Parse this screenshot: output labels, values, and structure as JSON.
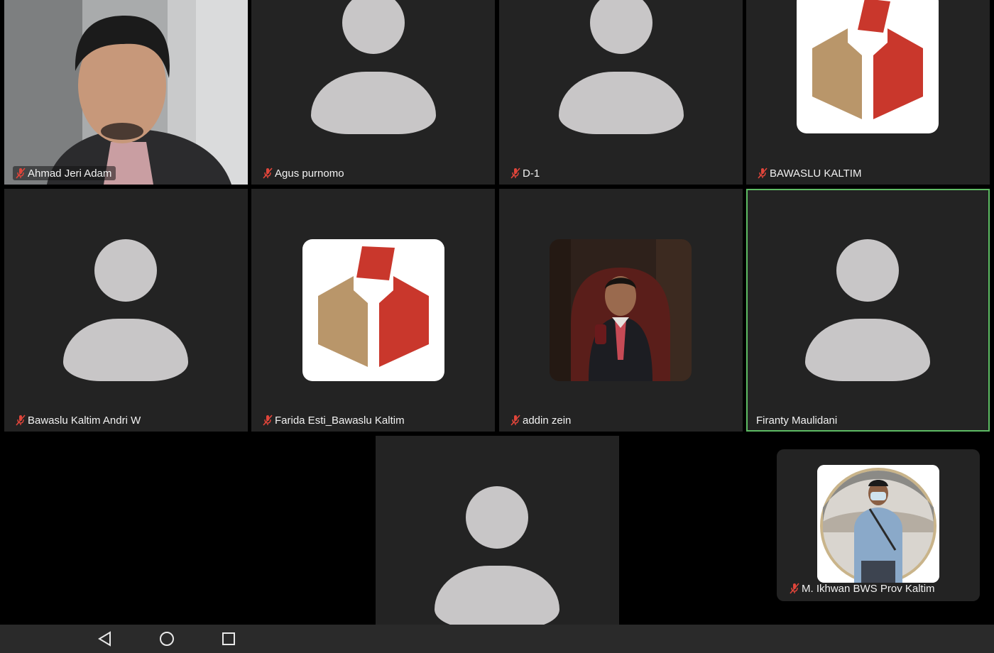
{
  "participants": [
    {
      "name": "Ahmad Jeri Adam",
      "muted": true,
      "video": "camera"
    },
    {
      "name": "Agus purnomo",
      "muted": true,
      "video": "placeholder-avatar"
    },
    {
      "name": "D-1",
      "muted": true,
      "video": "placeholder-avatar"
    },
    {
      "name": "BAWASLU KALTIM",
      "muted": true,
      "video": "bawaslu-logo"
    },
    {
      "name": "Bawaslu Kaltim Andri W",
      "muted": true,
      "video": "placeholder-avatar"
    },
    {
      "name": "Farida Esti_Bawaslu Kaltim",
      "muted": true,
      "video": "bawaslu-logo"
    },
    {
      "name": "addin zein",
      "muted": true,
      "video": "profile-photo"
    },
    {
      "name": "Firanty Maulidani",
      "muted": false,
      "video": "placeholder-avatar",
      "active_speaker": true
    },
    {
      "name": "",
      "muted": false,
      "video": "placeholder-avatar"
    },
    {
      "name": "M. Ikhwan BWS Prov Kaltim",
      "muted": true,
      "video": "profile-photo"
    }
  ],
  "icons": {
    "muted": "mic-off-icon",
    "nav_back": "back-triangle-icon",
    "nav_home": "home-circle-icon",
    "nav_recents": "recents-square-icon"
  },
  "colors": {
    "tile_bg": "#232323",
    "avatar": "#c8c6c7",
    "active_border": "#5dbb63",
    "mic_off": "#e0453a",
    "logo_gold": "#b9966a",
    "logo_red": "#c9372c"
  }
}
